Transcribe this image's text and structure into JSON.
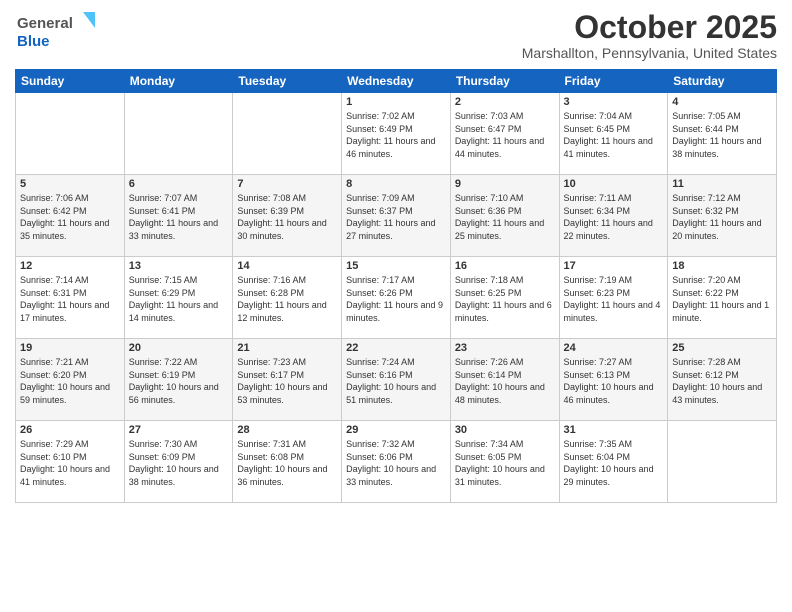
{
  "logo": {
    "line1": "General",
    "line2": "Blue"
  },
  "title": "October 2025",
  "subtitle": "Marshallton, Pennsylvania, United States",
  "days_of_week": [
    "Sunday",
    "Monday",
    "Tuesday",
    "Wednesday",
    "Thursday",
    "Friday",
    "Saturday"
  ],
  "weeks": [
    [
      {
        "day": "",
        "sunrise": "",
        "sunset": "",
        "daylight": ""
      },
      {
        "day": "",
        "sunrise": "",
        "sunset": "",
        "daylight": ""
      },
      {
        "day": "",
        "sunrise": "",
        "sunset": "",
        "daylight": ""
      },
      {
        "day": "1",
        "sunrise": "Sunrise: 7:02 AM",
        "sunset": "Sunset: 6:49 PM",
        "daylight": "Daylight: 11 hours and 46 minutes."
      },
      {
        "day": "2",
        "sunrise": "Sunrise: 7:03 AM",
        "sunset": "Sunset: 6:47 PM",
        "daylight": "Daylight: 11 hours and 44 minutes."
      },
      {
        "day": "3",
        "sunrise": "Sunrise: 7:04 AM",
        "sunset": "Sunset: 6:45 PM",
        "daylight": "Daylight: 11 hours and 41 minutes."
      },
      {
        "day": "4",
        "sunrise": "Sunrise: 7:05 AM",
        "sunset": "Sunset: 6:44 PM",
        "daylight": "Daylight: 11 hours and 38 minutes."
      }
    ],
    [
      {
        "day": "5",
        "sunrise": "Sunrise: 7:06 AM",
        "sunset": "Sunset: 6:42 PM",
        "daylight": "Daylight: 11 hours and 35 minutes."
      },
      {
        "day": "6",
        "sunrise": "Sunrise: 7:07 AM",
        "sunset": "Sunset: 6:41 PM",
        "daylight": "Daylight: 11 hours and 33 minutes."
      },
      {
        "day": "7",
        "sunrise": "Sunrise: 7:08 AM",
        "sunset": "Sunset: 6:39 PM",
        "daylight": "Daylight: 11 hours and 30 minutes."
      },
      {
        "day": "8",
        "sunrise": "Sunrise: 7:09 AM",
        "sunset": "Sunset: 6:37 PM",
        "daylight": "Daylight: 11 hours and 27 minutes."
      },
      {
        "day": "9",
        "sunrise": "Sunrise: 7:10 AM",
        "sunset": "Sunset: 6:36 PM",
        "daylight": "Daylight: 11 hours and 25 minutes."
      },
      {
        "day": "10",
        "sunrise": "Sunrise: 7:11 AM",
        "sunset": "Sunset: 6:34 PM",
        "daylight": "Daylight: 11 hours and 22 minutes."
      },
      {
        "day": "11",
        "sunrise": "Sunrise: 7:12 AM",
        "sunset": "Sunset: 6:32 PM",
        "daylight": "Daylight: 11 hours and 20 minutes."
      }
    ],
    [
      {
        "day": "12",
        "sunrise": "Sunrise: 7:14 AM",
        "sunset": "Sunset: 6:31 PM",
        "daylight": "Daylight: 11 hours and 17 minutes."
      },
      {
        "day": "13",
        "sunrise": "Sunrise: 7:15 AM",
        "sunset": "Sunset: 6:29 PM",
        "daylight": "Daylight: 11 hours and 14 minutes."
      },
      {
        "day": "14",
        "sunrise": "Sunrise: 7:16 AM",
        "sunset": "Sunset: 6:28 PM",
        "daylight": "Daylight: 11 hours and 12 minutes."
      },
      {
        "day": "15",
        "sunrise": "Sunrise: 7:17 AM",
        "sunset": "Sunset: 6:26 PM",
        "daylight": "Daylight: 11 hours and 9 minutes."
      },
      {
        "day": "16",
        "sunrise": "Sunrise: 7:18 AM",
        "sunset": "Sunset: 6:25 PM",
        "daylight": "Daylight: 11 hours and 6 minutes."
      },
      {
        "day": "17",
        "sunrise": "Sunrise: 7:19 AM",
        "sunset": "Sunset: 6:23 PM",
        "daylight": "Daylight: 11 hours and 4 minutes."
      },
      {
        "day": "18",
        "sunrise": "Sunrise: 7:20 AM",
        "sunset": "Sunset: 6:22 PM",
        "daylight": "Daylight: 11 hours and 1 minute."
      }
    ],
    [
      {
        "day": "19",
        "sunrise": "Sunrise: 7:21 AM",
        "sunset": "Sunset: 6:20 PM",
        "daylight": "Daylight: 10 hours and 59 minutes."
      },
      {
        "day": "20",
        "sunrise": "Sunrise: 7:22 AM",
        "sunset": "Sunset: 6:19 PM",
        "daylight": "Daylight: 10 hours and 56 minutes."
      },
      {
        "day": "21",
        "sunrise": "Sunrise: 7:23 AM",
        "sunset": "Sunset: 6:17 PM",
        "daylight": "Daylight: 10 hours and 53 minutes."
      },
      {
        "day": "22",
        "sunrise": "Sunrise: 7:24 AM",
        "sunset": "Sunset: 6:16 PM",
        "daylight": "Daylight: 10 hours and 51 minutes."
      },
      {
        "day": "23",
        "sunrise": "Sunrise: 7:26 AM",
        "sunset": "Sunset: 6:14 PM",
        "daylight": "Daylight: 10 hours and 48 minutes."
      },
      {
        "day": "24",
        "sunrise": "Sunrise: 7:27 AM",
        "sunset": "Sunset: 6:13 PM",
        "daylight": "Daylight: 10 hours and 46 minutes."
      },
      {
        "day": "25",
        "sunrise": "Sunrise: 7:28 AM",
        "sunset": "Sunset: 6:12 PM",
        "daylight": "Daylight: 10 hours and 43 minutes."
      }
    ],
    [
      {
        "day": "26",
        "sunrise": "Sunrise: 7:29 AM",
        "sunset": "Sunset: 6:10 PM",
        "daylight": "Daylight: 10 hours and 41 minutes."
      },
      {
        "day": "27",
        "sunrise": "Sunrise: 7:30 AM",
        "sunset": "Sunset: 6:09 PM",
        "daylight": "Daylight: 10 hours and 38 minutes."
      },
      {
        "day": "28",
        "sunrise": "Sunrise: 7:31 AM",
        "sunset": "Sunset: 6:08 PM",
        "daylight": "Daylight: 10 hours and 36 minutes."
      },
      {
        "day": "29",
        "sunrise": "Sunrise: 7:32 AM",
        "sunset": "Sunset: 6:06 PM",
        "daylight": "Daylight: 10 hours and 33 minutes."
      },
      {
        "day": "30",
        "sunrise": "Sunrise: 7:34 AM",
        "sunset": "Sunset: 6:05 PM",
        "daylight": "Daylight: 10 hours and 31 minutes."
      },
      {
        "day": "31",
        "sunrise": "Sunrise: 7:35 AM",
        "sunset": "Sunset: 6:04 PM",
        "daylight": "Daylight: 10 hours and 29 minutes."
      },
      {
        "day": "",
        "sunrise": "",
        "sunset": "",
        "daylight": ""
      }
    ]
  ]
}
